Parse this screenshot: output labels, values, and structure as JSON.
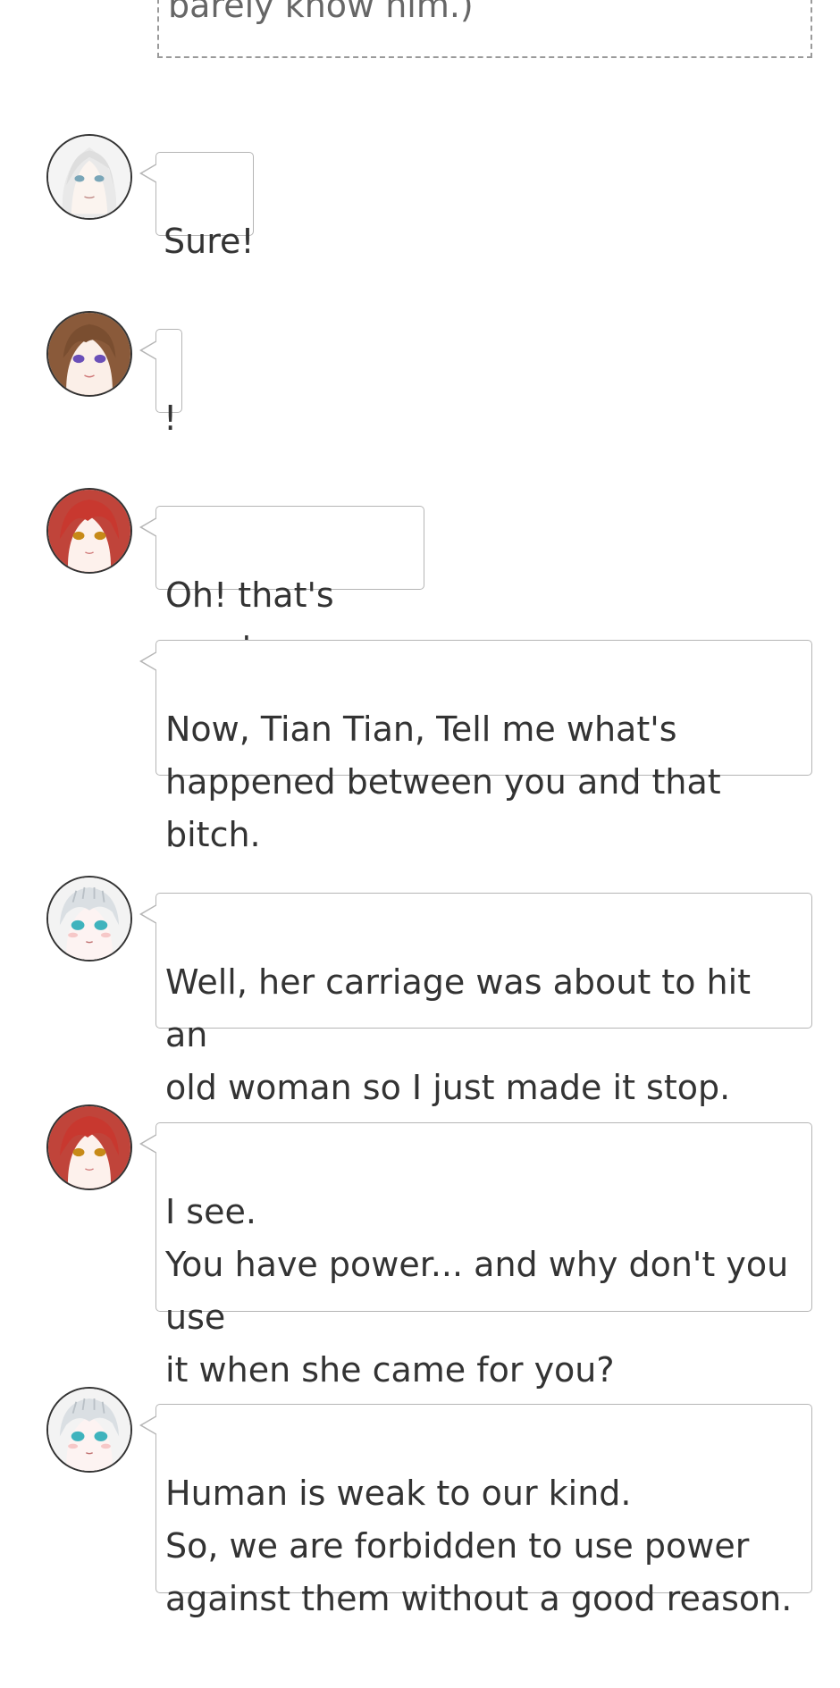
{
  "previous_thought": {
    "text": "barely know him.)"
  },
  "messages": [
    {
      "avatar_icon": "white-hair-girl-avatar-icon",
      "text": "Sure!"
    },
    {
      "avatar_icon": "brown-hair-girl-avatar-icon",
      "text": "!"
    },
    {
      "avatar_icon": "red-hair-girl-avatar-icon",
      "text": "Oh! that's great."
    },
    {
      "avatar_icon": "",
      "text": "Now, Tian Tian, Tell me what's\nhappened between you and that bitch."
    },
    {
      "avatar_icon": "silver-hair-girl-avatar-icon",
      "text": "Well, her carriage was about to hit an\nold woman so I just made it stop."
    },
    {
      "avatar_icon": "red-hair-girl-avatar-icon",
      "text": "I see.\nYou have power... and why don't you use\nit when she came for you?"
    },
    {
      "avatar_icon": "silver-hair-girl-avatar-icon",
      "text": "Human is weak to our kind.\nSo, we are forbidden to use power\nagainst them without a good reason."
    }
  ],
  "colors": {
    "bubble_border": "#b5b5b5",
    "text": "#333333",
    "thought_border": "#9a9a9a",
    "thought_text": "#666666"
  }
}
